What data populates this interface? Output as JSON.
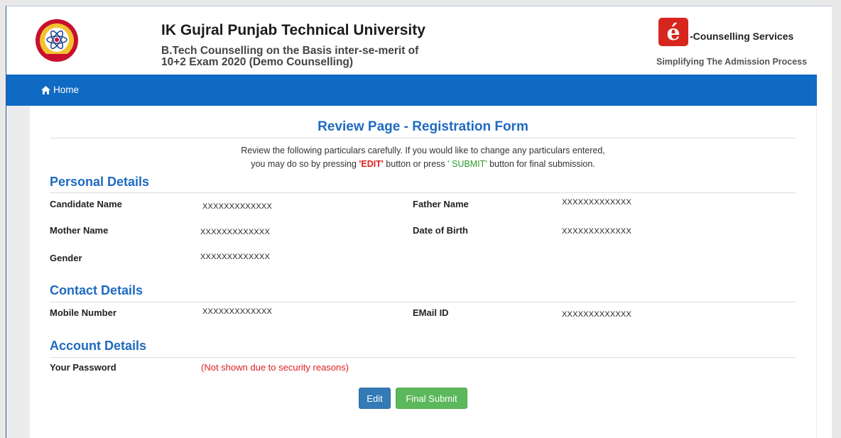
{
  "header": {
    "university_name": "IK Gujral Punjab Technical University",
    "subtitle_line1": "B.Tech Counselling on the Basis inter-se-merit of",
    "subtitle_line2": "10+2 Exam 2020 (Demo Counselling)",
    "service_name": "-Counselling Services",
    "service_tagline": "Simplifying The Admission Process",
    "logo_glyph": "é"
  },
  "nav": {
    "home_label": "Home",
    "home_icon": "home-icon"
  },
  "page": {
    "title": "Review Page - Registration Form",
    "instruction_line1": "Review the following particulars carefully. If you would like to change any particulars entered,",
    "instruction_line2_pre": "you may do so by pressing ",
    "instruction_edit": "'EDIT'",
    "instruction_mid": " button or press ",
    "instruction_submit": "' SUBMIT'",
    "instruction_post": " button for final submission."
  },
  "personal": {
    "heading": "Personal Details",
    "candidate_name_label": "Candidate Name",
    "candidate_name_value": "XXXXXXXXXXXXX",
    "father_name_label": "Father Name",
    "father_name_value": "XXXXXXXXXXXXX",
    "mother_name_label": "Mother Name",
    "mother_name_value": "XXXXXXXXXXXXX",
    "dob_label": "Date of Birth",
    "dob_value": "XXXXXXXXXXXXX",
    "gender_label": "Gender",
    "gender_value": "XXXXXXXXXXXXX"
  },
  "contact": {
    "heading": "Contact Details",
    "mobile_label": "Mobile Number",
    "mobile_value": "XXXXXXXXXXXXX",
    "email_label": "EMail ID",
    "email_value": "XXXXXXXXXXXXX"
  },
  "account": {
    "heading": "Account Details",
    "password_label": "Your Password",
    "password_value": "(Not shown due to security reasons)"
  },
  "buttons": {
    "edit_label": "Edit",
    "submit_label": "Final Submit"
  },
  "colors": {
    "brand_blue": "#0f6ac3",
    "heading_blue": "#1f6ac0",
    "alert_red": "#e02020",
    "success_green": "#5cb85c",
    "primary_blue": "#337ab7"
  }
}
